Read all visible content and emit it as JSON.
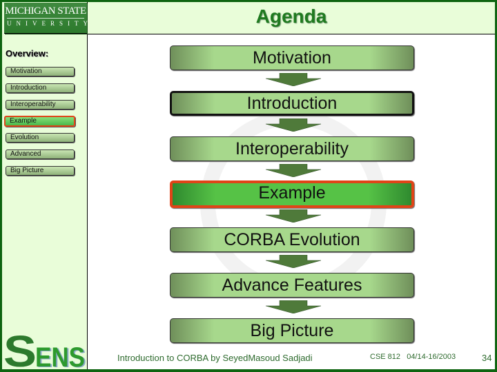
{
  "logo": {
    "line1": "MICHIGAN STATE",
    "line2": "UNIVERSITY"
  },
  "slide": {
    "title": "Agenda"
  },
  "sidebar": {
    "heading": "Overview:",
    "items": [
      {
        "label": "Motivation",
        "active": false
      },
      {
        "label": "Introduction",
        "active": false
      },
      {
        "label": "Interoperability",
        "active": false
      },
      {
        "label": "Example",
        "active": true
      },
      {
        "label": "Evolution",
        "active": false
      },
      {
        "label": "Advanced",
        "active": false
      },
      {
        "label": "Big Picture",
        "active": false
      }
    ]
  },
  "flow": {
    "steps": [
      {
        "label": "Motivation"
      },
      {
        "label": "Introduction"
      },
      {
        "label": "Interoperability"
      },
      {
        "label": "Example"
      },
      {
        "label": "CORBA Evolution"
      },
      {
        "label": "Advance Features"
      },
      {
        "label": "Big Picture"
      }
    ],
    "highlighted_step": "Example"
  },
  "footer": {
    "sens_logo": "SENS",
    "course_title": "Introduction to CORBA by SeyedMasoud Sadjadi",
    "course_info": "CSE 812   04/14-16/2003",
    "page_number": "34"
  },
  "colors": {
    "brand_green": "#0e6410",
    "highlight": "#e04418",
    "panel_bg": "#e9fdd9"
  }
}
